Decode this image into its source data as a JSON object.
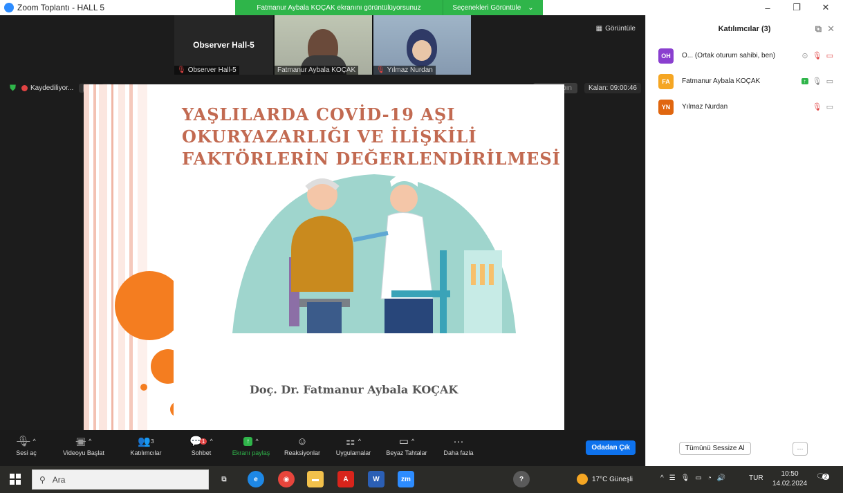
{
  "titlebar": {
    "title": "Zoom Toplantı - HALL 5",
    "share_banner": "Fatmanur Aybala KOÇAK ekranını görüntülüyorsunuz",
    "view_options": "Seçenekleri Görüntüle",
    "minimize": "–",
    "maximize": "❐",
    "close": "✕"
  },
  "videos": {
    "main_name": "Observer Hall-5",
    "tiles": [
      {
        "label": "Observer Hall-5"
      },
      {
        "label": "Fatmanur Aybala KOÇAK"
      },
      {
        "label": "Yılmaz Nurdan"
      }
    ],
    "view_button": "Görüntüle"
  },
  "recording": {
    "label": "Kaydediliyor...",
    "pause": "❚❚",
    "stop": "■"
  },
  "remaining": "Kalan: 09:00:46",
  "request_control": "Giriş yapın",
  "slide": {
    "title_lines": [
      "YAŞLILARDA COVİD-19 AŞI",
      "OKURYAZARLIĞI VE İLİŞKİLİ",
      "FAKTÖRLERİN DEĞERLENDİRİLMESİ"
    ],
    "author": "Doç. Dr. Fatmanur Aybala KOÇAK"
  },
  "toolbar": [
    {
      "label": "Sesi aç",
      "icon": "mic-off-icon"
    },
    {
      "label": "Videoyu Başlat",
      "icon": "video-off-icon"
    },
    {
      "label": "Katılımcılar",
      "icon": "participants-icon",
      "count": "3"
    },
    {
      "label": "Sohbet",
      "icon": "chat-icon",
      "badge": "1"
    },
    {
      "label": "Ekranı paylaş",
      "icon": "share-screen-icon"
    },
    {
      "label": "Reaksiyonlar",
      "icon": "reactions-icon"
    },
    {
      "label": "Uygulamalar",
      "icon": "apps-icon"
    },
    {
      "label": "Beyaz Tahtalar",
      "icon": "whiteboard-icon"
    },
    {
      "label": "Daha fazla",
      "icon": "more-icon"
    }
  ],
  "leave_button": "Odadan Çık",
  "participants": {
    "header": "Katılımcılar (3)",
    "list": [
      {
        "initials": "OH",
        "name": "O... (Ortak oturum sahibi, ben)",
        "color": "#8a3fcf"
      },
      {
        "initials": "FA",
        "name": "Fatmanur Aybala KOÇAK",
        "color": "#f5a623"
      },
      {
        "initials": "YN",
        "name": "Yılmaz Nurdan",
        "color": "#e0660f"
      }
    ],
    "mute_all": "Tümünü Sessize Al",
    "more": "···"
  },
  "taskbar": {
    "search_placeholder": "Ara",
    "weather": "17°C Güneşli",
    "language": "TUR",
    "time": "10:50",
    "date": "14.02.2024",
    "notifications": "2"
  },
  "colors": {
    "accent_blue": "#0e72ed",
    "share_green": "#2fb54a",
    "title_orange": "#c26a51",
    "circle_orange": "#f47d20"
  }
}
